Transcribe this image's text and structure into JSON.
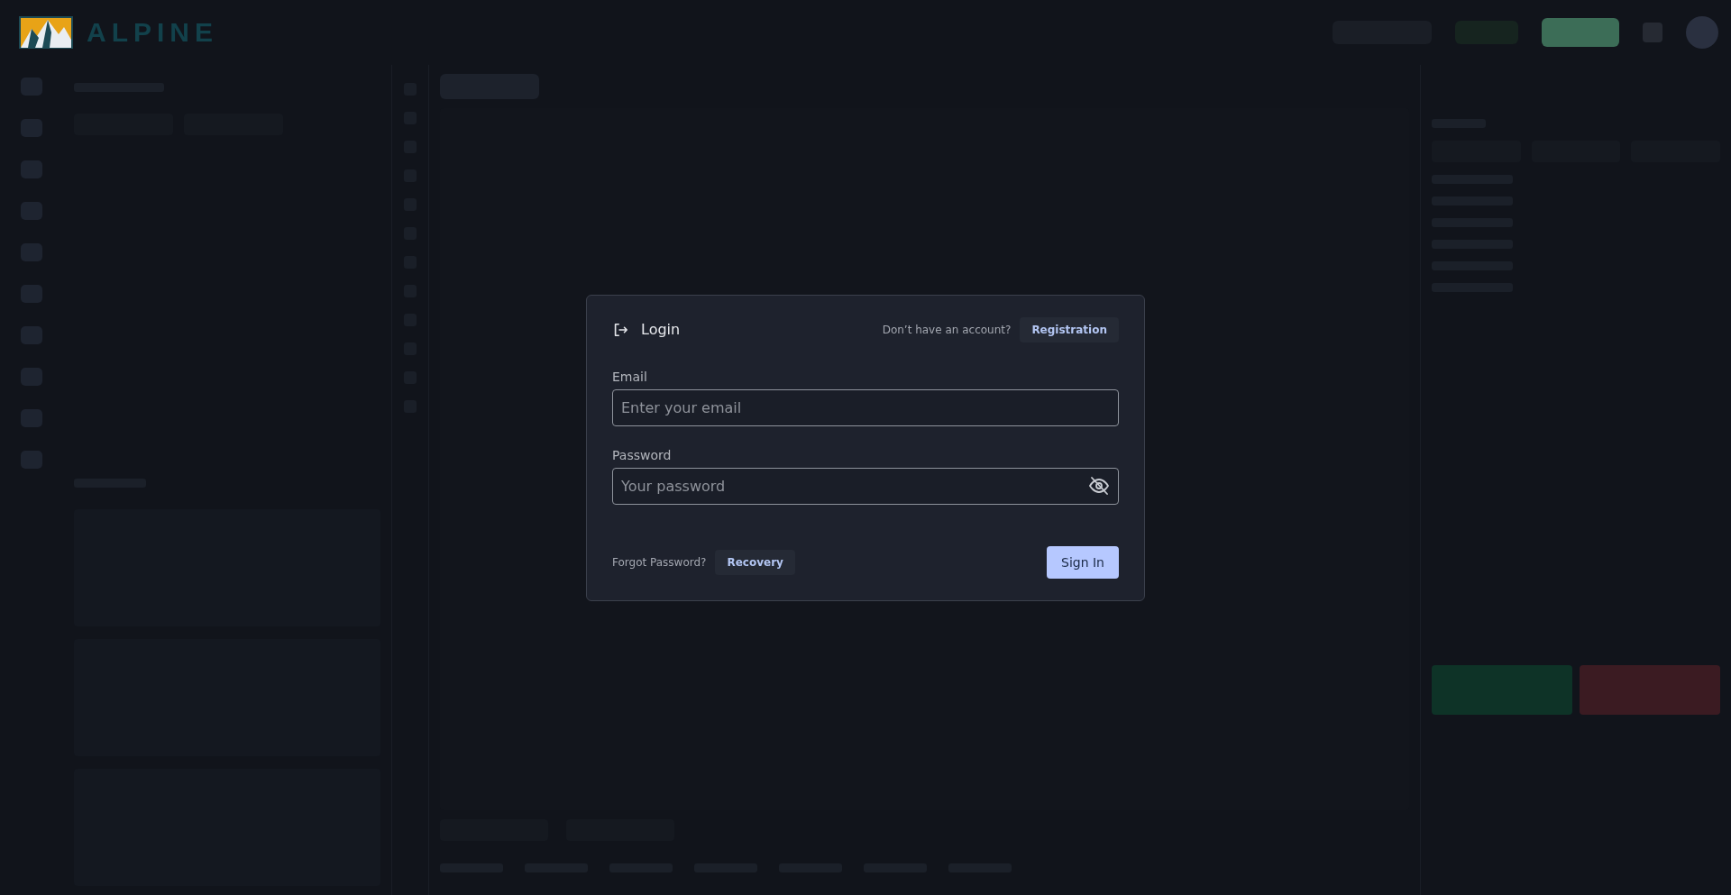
{
  "logo": {
    "name": "ALPINE"
  },
  "login": {
    "title": "Login",
    "register_prompt": "Don’t have an account?",
    "register_button": "Registration",
    "fields": [
      {
        "kind": "email",
        "label": "Email",
        "placeholder": "Enter your email"
      },
      {
        "kind": "password",
        "label": "Password",
        "placeholder": "Your password",
        "revealed": false
      }
    ],
    "forgot_prompt": "Forgot Password?",
    "recovery_button": "Recovery",
    "submit_button": "Sign In"
  }
}
